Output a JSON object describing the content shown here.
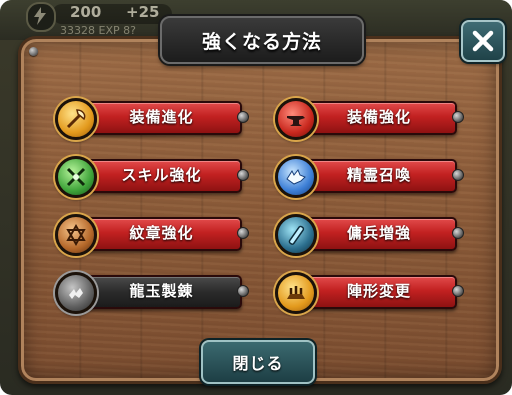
{
  "hud": {
    "energy": "200",
    "plus": "+25",
    "exp": "33328 EXP  8?"
  },
  "dialog": {
    "title": "強くなる方法",
    "close_icon": "x-icon",
    "close_button_label": "閉じる"
  },
  "menu": {
    "items": [
      {
        "label": "装備進化",
        "icon": "axe-icon",
        "color": "#c22121"
      },
      {
        "label": "装備強化",
        "icon": "anvil-icon",
        "color": "#c22121"
      },
      {
        "label": "スキル強化",
        "icon": "crossed-swords-icon",
        "color": "#c22121"
      },
      {
        "label": "精霊召喚",
        "icon": "spirit-wolf-icon",
        "color": "#c22121"
      },
      {
        "label": "紋章強化",
        "icon": "hexagram-icon",
        "color": "#c22121"
      },
      {
        "label": "傭兵増強",
        "icon": "scroll-icon",
        "color": "#c22121"
      },
      {
        "label": "龍玉製錬",
        "icon": "dragon-orb-icon",
        "color": "#2b2b2b"
      },
      {
        "label": "陣形変更",
        "icon": "formation-icon",
        "color": "#c22121"
      }
    ]
  }
}
